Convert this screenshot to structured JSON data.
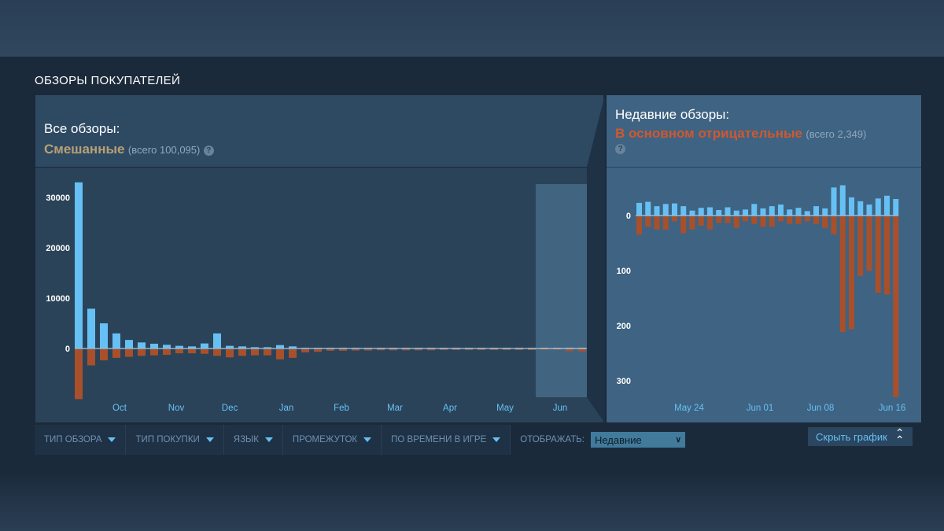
{
  "section_title": "ОБЗОРЫ ПОКУПАТЕЛЕЙ",
  "all_reviews": {
    "label": "Все обзоры:",
    "rating": "Смешанные",
    "total": "(всего 100,095)",
    "help": "?"
  },
  "recent_reviews": {
    "label": "Недавние обзоры:",
    "rating": "В основном отрицательные",
    "total": "(всего 2,349)",
    "help": "?"
  },
  "filters": [
    {
      "label": "ТИП ОБЗОРА"
    },
    {
      "label": "ТИП ПОКУПКИ"
    },
    {
      "label": "ЯЗЫК"
    },
    {
      "label": "ПРОМЕЖУТОК"
    },
    {
      "label": "ПО ВРЕМЕНИ В ИГРЕ"
    }
  ],
  "display": {
    "label": "ОТОБРАЖАТЬ:",
    "selected": "Недавние"
  },
  "hide_graph": "Скрыть график",
  "colors": {
    "positive": "#66c0f4",
    "negative": "#a9502a",
    "mixed": "#b9a074",
    "negative_text": "#d0582f"
  },
  "chart_data": [
    {
      "type": "bar",
      "title": "Все обзоры",
      "ylim": [
        -10000,
        33000
      ],
      "yticks": [
        "30000",
        "20000",
        "10000",
        "0"
      ],
      "ytick_values": [
        30000,
        20000,
        10000,
        0
      ],
      "xticks": [
        "Oct",
        "Nov",
        "Dec",
        "Jan",
        "Feb",
        "Mar",
        "Apr",
        "May",
        "Jun"
      ],
      "series": [
        {
          "name": "positive",
          "values": [
            33000,
            7900,
            5000,
            3000,
            1700,
            1200,
            950,
            740,
            530,
            420,
            1000,
            3000,
            530,
            420,
            260,
            260,
            680,
            420,
            150,
            120,
            100,
            100,
            100,
            100,
            80,
            80,
            80,
            80,
            80,
            60,
            60,
            60,
            60,
            80,
            60,
            60,
            60,
            40,
            40,
            40,
            40
          ]
        },
        {
          "name": "negative",
          "values": [
            -9900,
            -3200,
            -2200,
            -1700,
            -1500,
            -1300,
            -1200,
            -1100,
            -800,
            -800,
            -900,
            -1300,
            -1600,
            -1300,
            -1200,
            -1200,
            -2000,
            -1700,
            -600,
            -500,
            -300,
            -300,
            -250,
            -250,
            -200,
            -200,
            -200,
            -200,
            -200,
            -150,
            -150,
            -150,
            -150,
            -150,
            -120,
            -120,
            -120,
            -120,
            -120,
            -400,
            -450
          ]
        }
      ],
      "highlight_range": "Jun"
    },
    {
      "type": "bar",
      "title": "Недавние обзоры",
      "ylim": [
        -340,
        60
      ],
      "yticks": [
        "0",
        "100",
        "200",
        "300"
      ],
      "ytick_values": [
        0,
        -100,
        -200,
        -300
      ],
      "xticks": [
        "May 24",
        "Jun 01",
        "Jun 08",
        "Jun 16"
      ],
      "series": [
        {
          "name": "positive",
          "values": [
            23,
            25,
            17,
            21,
            22,
            17,
            9,
            14,
            15,
            10,
            15,
            9,
            11,
            21,
            13,
            17,
            20,
            11,
            14,
            8,
            17,
            13,
            51,
            55,
            33,
            26,
            20,
            31,
            36,
            30
          ]
        },
        {
          "name": "negative",
          "values": [
            -33,
            -19,
            -24,
            -24,
            -9,
            -31,
            -24,
            -17,
            -24,
            -12,
            -12,
            -21,
            -9,
            -14,
            -19,
            -19,
            -9,
            -14,
            -14,
            -9,
            -14,
            -21,
            -33,
            -210,
            -205,
            -108,
            -99,
            -139,
            -142,
            -328
          ]
        }
      ]
    }
  ]
}
